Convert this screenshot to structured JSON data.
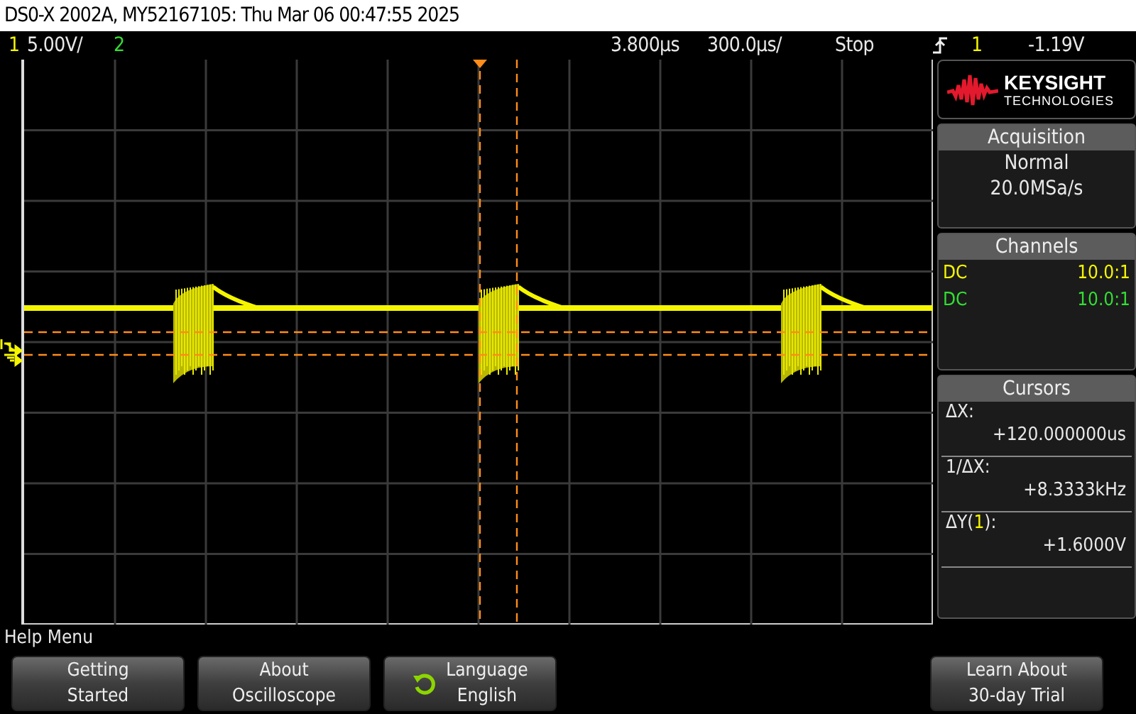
{
  "title": "DS0-X 2002A, MY52167105: Thu Mar 06 00:47:55 2025",
  "status_bar": {
    "channels": [
      {
        "label": "1",
        "color": "#f5f500"
      },
      {
        "label": "2",
        "color": "#33dd33"
      }
    ],
    "ch1_scale": "5.00V/",
    "delay": "3.800µs",
    "timebase": "300.0µs/",
    "run_state": "Stop",
    "trigger_source": "1",
    "trigger_level": "-1.19V"
  },
  "logo": {
    "name": "KEYSIGHT",
    "subtitle": "TECHNOLOGIES"
  },
  "acquisition": {
    "header": "Acquisition",
    "mode": "Normal",
    "rate": "20.0MSa/s"
  },
  "channels_panel": {
    "header": "Channels",
    "rows": [
      {
        "coupling": "DC",
        "probe": "10.0:1",
        "color": "#f5f500"
      },
      {
        "coupling": "DC",
        "probe": "10.0:1",
        "color": "#33dd33"
      }
    ]
  },
  "cursors": {
    "header": "Cursors",
    "items": [
      {
        "quantity": "ΔX:",
        "reading": "+120.000000us"
      },
      {
        "quantity": "1/ΔX:",
        "reading": "+8.3333kHz"
      },
      {
        "quantity": "ΔY(",
        "channel": "1",
        "quantity_end": "):",
        "reading": "+1.6000V"
      }
    ]
  },
  "menu_title": "Help Menu",
  "softkeys": [
    {
      "kind": "plain",
      "lines": [
        "Getting",
        "Started"
      ]
    },
    {
      "kind": "plain",
      "lines": [
        "About",
        "Oscilloscope"
      ]
    },
    {
      "kind": "cycle",
      "lines": [
        "Language",
        "English"
      ]
    },
    {
      "kind": "plain",
      "lines": [
        "Learn About",
        "30-day Trial"
      ]
    }
  ]
}
